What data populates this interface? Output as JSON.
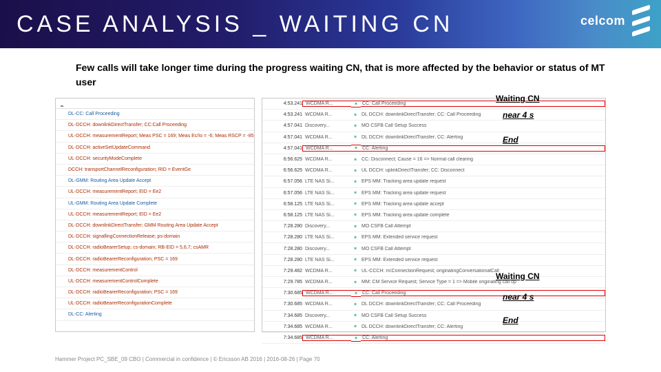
{
  "header": {
    "title": "CASE ANALYSIS _ WAITING CN",
    "brand1": "celcom"
  },
  "subtitle": "Few calls will take longer time during the progress waiting CN, that is more affected by the behavior or status of MT user",
  "left": {
    "header": "",
    "rows": [
      {
        "t": "DL-CC: Call Proceeding",
        "c": "blue"
      },
      {
        "t": "DL-DCCH: downlinkDirectTransfer; CC:Call Proceeding",
        "c": "red"
      },
      {
        "t": "UL-DCCH: measurementReport; Meas PSC = 169; Meas Ec/Io = -6; Meas RSCP = -85",
        "c": "red"
      },
      {
        "t": "DL-DCCH: activeSetUpdateCommand",
        "c": "red"
      },
      {
        "t": "UL-DCCH: securityModeComplete",
        "c": "red"
      },
      {
        "t": "DCCH: transportChannelReconfiguration; RID = EventGe",
        "c": "red"
      },
      {
        "t": "DL-GMM: Routing Area Update Accept",
        "c": "blue"
      },
      {
        "t": "UL-DCCH: measurementReport; EID = Ee2",
        "c": "red"
      },
      {
        "t": "UL-GMM: Routing Area Update Complete",
        "c": "blue"
      },
      {
        "t": "UL-DCCH: measurementReport; EID = Ee2",
        "c": "red"
      },
      {
        "t": "DL-DCCH: downlinkDirectTransfer; GMM Routing Area Update Accept",
        "c": "red"
      },
      {
        "t": "DL-DCCH: signallingConnectionRelease; ps-domain",
        "c": "red"
      },
      {
        "t": "DL-DCCH: radioBearerSetup; cs-domain; RB-EID = 5,6,7; csAMR",
        "c": "red"
      },
      {
        "t": "DL-DCCH: radioBearerReconfiguration; PSC = 169",
        "c": "red"
      },
      {
        "t": "DL-DCCH: measurementControl",
        "c": "red"
      },
      {
        "t": "UL-DCCH: measurementControlComplete",
        "c": "red"
      },
      {
        "t": "DL-DCCH: radioBearerReconfiguration; PSC = 169",
        "c": "red"
      },
      {
        "t": "UL-DCCH: radioBearerReconfigurationComplete",
        "c": "red"
      },
      {
        "t": "DL-CC: Alerting",
        "c": "blue"
      }
    ]
  },
  "right": {
    "rows": [
      {
        "time": "4:53.241",
        "tech": "WCDMA R...",
        "msg": "CC: Call Proceeding",
        "hi": true
      },
      {
        "time": "4:53.241",
        "tech": "WCDMA R...",
        "msg": "DL DCCH: downlinkDirectTransfer; CC: Call Proceeding",
        "hi": false
      },
      {
        "time": "4:57.041",
        "tech": "Discovery...",
        "msg": "MO CSFB Call Setup Success",
        "hi": false
      },
      {
        "time": "4:57.041",
        "tech": "WCDMA R...",
        "msg": "DL DCCH: downlinkDirectTransfer; CC: Alerting",
        "hi": false
      },
      {
        "time": "4:57.041",
        "tech": "WCDMA R...",
        "msg": "CC: Alerting",
        "hi": true
      },
      {
        "time": "6:56.625",
        "tech": "WCDMA R...",
        "msg": "CC: Disconnect; Cause = 16 => Normal call clearing",
        "hi": false
      },
      {
        "time": "6:56.625",
        "tech": "WCDMA R...",
        "msg": "UL DCCH: uplinkDirectTransfer; CC: Disconnect",
        "hi": false
      },
      {
        "time": "6:57.056",
        "tech": "LTE NAS Si...",
        "msg": "EPS MM: Tracking area update request",
        "hi": false
      },
      {
        "time": "6:57.056",
        "tech": "LTE NAS Si...",
        "msg": "EPS MM: Tracking area update request",
        "hi": false
      },
      {
        "time": "6:58.125",
        "tech": "LTE NAS Si...",
        "msg": "EPS MM: Tracking area update accept",
        "hi": false
      },
      {
        "time": "6:58.125",
        "tech": "LTE NAS Si...",
        "msg": "EPS MM: Tracking area update complete",
        "hi": false
      },
      {
        "time": "7:28.280",
        "tech": "Discovery...",
        "msg": "MO CSFB Call Attempt",
        "hi": false
      },
      {
        "time": "7:28.280",
        "tech": "LTE NAS Si...",
        "msg": "EPS MM: Extended service request",
        "hi": false
      },
      {
        "time": "7:28.280",
        "tech": "Discovery...",
        "msg": "MO CSFB Call Attempt",
        "hi": false
      },
      {
        "time": "7:28.280",
        "tech": "LTE NAS Si...",
        "msg": "EPS MM: Extended service request",
        "hi": false
      },
      {
        "time": "7:29.482",
        "tech": "WCDMA R...",
        "msg": "UL-CCCH: rrcConnectionRequest; originatingConversationalCall",
        "hi": false
      },
      {
        "time": "7:29.785",
        "tech": "WCDMA R...",
        "msg": "MM: CM Service Request; Service Type = 1 => Mobile originating call op",
        "hi": false
      },
      {
        "time": "7:30.685",
        "tech": "WCDMA R...",
        "msg": "CC: Call Proceeding",
        "hi": true
      },
      {
        "time": "7:30.685",
        "tech": "WCDMA R...",
        "msg": "DL DCCH: downlinkDirectTransfer; CC: Call Proceeding",
        "hi": false
      },
      {
        "time": "7:34.685",
        "tech": "Discovery...",
        "msg": "MO CSFB Call Setup Success",
        "hi": false
      },
      {
        "time": "7:34.685",
        "tech": "WCDMA R...",
        "msg": "DL DCCH: downlinkDirectTransfer; CC: Alerting",
        "hi": false
      },
      {
        "time": "7:34.685",
        "tech": "WCDMA R...",
        "msg": "CC: Alerting",
        "hi": true
      }
    ]
  },
  "annotations": {
    "a1": "Waiting CN",
    "a2": "near 4 s",
    "a3": "End",
    "a4": "Waiting CN",
    "a5": "near 4 s",
    "a6": "End"
  },
  "footer": "Hammer Project PC_SBE_09 CBO  |  Commercial in confidence  |  © Ericsson AB 2016  |  2016-08-26  |  Page  70"
}
